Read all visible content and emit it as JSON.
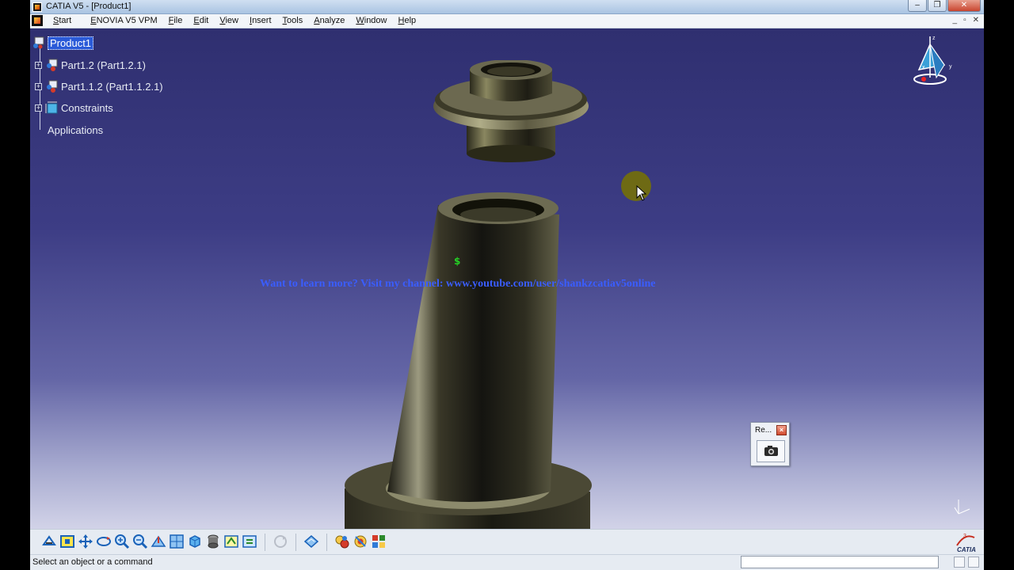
{
  "window": {
    "title": "CATIA V5 - [Product1]"
  },
  "menubar": {
    "items": [
      "Start",
      "ENOVIA V5 VPM",
      "File",
      "Edit",
      "View",
      "Insert",
      "Tools",
      "Analyze",
      "Window",
      "Help"
    ]
  },
  "tree": {
    "root": "Product1",
    "nodes": [
      {
        "label": "Part1.2 (Part1.2.1)"
      },
      {
        "label": "Part1.1.2 (Part1.1.2.1)"
      },
      {
        "label": "Constraints"
      },
      {
        "label": "Applications"
      }
    ]
  },
  "viewport": {
    "watermark": "Want to learn more? Visit my channel: www.youtube.com/user/shankzcatiav5online"
  },
  "floating_toolbar": {
    "title": "Re..."
  },
  "statusbar": {
    "message": "Select an object or a command",
    "command_input": ""
  },
  "colors": {
    "viewport_top": "#2f2f70",
    "viewport_bottom": "#d2d3e8",
    "selection": "#2a5ad8",
    "watermark": "#3a5dff"
  }
}
